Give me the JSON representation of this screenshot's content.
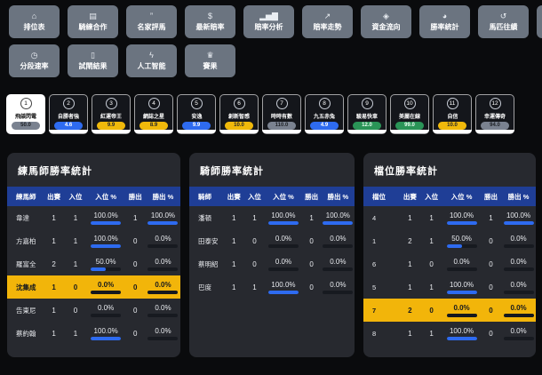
{
  "colors": {
    "background": "#0a0b0d",
    "nav_button": "#6b7480",
    "panel": "#27292f",
    "table_header": "#1f3e96",
    "highlight_row": "#f2b50a",
    "bar_fill": "#2e6bf0",
    "badge_blue": "#2e6bf0",
    "badge_yellow": "#f0b90b",
    "badge_green": "#2a9457",
    "badge_gray": "#7a8290"
  },
  "nav": {
    "row1": [
      {
        "label": "排位表",
        "icon": "home-icon",
        "glyph": "⌂"
      },
      {
        "label": "騎練合作",
        "icon": "id-card-icon",
        "glyph": "▤"
      },
      {
        "label": "名家評馬",
        "icon": "quote-icon",
        "glyph": "”"
      },
      {
        "label": "最新賠率",
        "icon": "dollar-icon",
        "glyph": "$"
      },
      {
        "label": "賠率分析",
        "icon": "bar-chart-icon",
        "glyph": "▂▅▇"
      },
      {
        "label": "賠率走勢",
        "icon": "line-chart-icon",
        "glyph": "↗"
      },
      {
        "label": "資金流向",
        "icon": "droplet-icon",
        "glyph": "◈"
      },
      {
        "label": "勝率統計",
        "icon": "pie-chart-icon",
        "glyph": "◕"
      },
      {
        "label": "馬匹往績",
        "icon": "history-icon",
        "glyph": "↺"
      },
      {
        "label": "",
        "icon": "partial-button",
        "glyph": "",
        "partial": true
      }
    ],
    "row2": [
      {
        "label": "分段速率",
        "icon": "clock-icon",
        "glyph": "◷"
      },
      {
        "label": "試閘結果",
        "icon": "gate-icon",
        "glyph": "▯"
      },
      {
        "label": "人工智能",
        "icon": "lightning-icon",
        "glyph": "ϟ"
      },
      {
        "label": "賽果",
        "icon": "trophy-icon",
        "glyph": "♛"
      }
    ]
  },
  "horses": [
    {
      "num": "1",
      "name": "飛燄閃電",
      "odds": "50.0",
      "badge": "gray",
      "selected": true
    },
    {
      "num": "2",
      "name": "自勝者強",
      "odds": "4.6",
      "badge": "blue",
      "selected": false
    },
    {
      "num": "3",
      "name": "紅運帝王",
      "odds": "9.9",
      "badge": "yellow",
      "selected": false
    },
    {
      "num": "4",
      "name": "網誌之星",
      "odds": "8.9",
      "badge": "yellow",
      "selected": false
    },
    {
      "num": "5",
      "name": "安逸",
      "odds": "9.9",
      "badge": "blue",
      "selected": false
    },
    {
      "num": "6",
      "name": "創新智感",
      "odds": "10.0",
      "badge": "yellow",
      "selected": false
    },
    {
      "num": "7",
      "name": "時時有數",
      "odds": "110.0",
      "badge": "gray",
      "selected": false
    },
    {
      "num": "8",
      "name": "九五赤兔",
      "odds": "4.9",
      "badge": "blue",
      "selected": false
    },
    {
      "num": "9",
      "name": "駿易快車",
      "odds": "12.0",
      "badge": "green",
      "selected": false
    },
    {
      "num": "10",
      "name": "美麗在線",
      "odds": "99.0",
      "badge": "green",
      "selected": false
    },
    {
      "num": "11",
      "name": "自信",
      "odds": "10.0",
      "badge": "yellow",
      "selected": false
    },
    {
      "num": "12",
      "name": "幸運傳奇",
      "odds": "94.0",
      "badge": "gray",
      "selected": false
    }
  ],
  "tables": [
    {
      "title": "練馬師勝率統計",
      "columns": [
        "練馬師",
        "出賽",
        "入位",
        "入位 %",
        "勝出",
        "勝出 %"
      ],
      "rows": [
        {
          "name": "韋達",
          "starts": "1",
          "placed": "1",
          "place_pct": "100.0%",
          "place_val": 100,
          "wins": "1",
          "win_pct": "100.0%",
          "win_val": 100,
          "highlight": false
        },
        {
          "name": "方嘉柏",
          "starts": "1",
          "placed": "1",
          "place_pct": "100.0%",
          "place_val": 100,
          "wins": "0",
          "win_pct": "0.0%",
          "win_val": 0,
          "highlight": false
        },
        {
          "name": "羅富全",
          "starts": "2",
          "placed": "1",
          "place_pct": "50.0%",
          "place_val": 50,
          "wins": "0",
          "win_pct": "0.0%",
          "win_val": 0,
          "highlight": false
        },
        {
          "name": "沈集成",
          "starts": "1",
          "placed": "0",
          "place_pct": "0.0%",
          "place_val": 0,
          "wins": "0",
          "win_pct": "0.0%",
          "win_val": 0,
          "highlight": true
        },
        {
          "name": "告東尼",
          "starts": "1",
          "placed": "0",
          "place_pct": "0.0%",
          "place_val": 0,
          "wins": "0",
          "win_pct": "0.0%",
          "win_val": 0,
          "highlight": false
        },
        {
          "name": "蔡約翰",
          "starts": "1",
          "placed": "1",
          "place_pct": "100.0%",
          "place_val": 100,
          "wins": "0",
          "win_pct": "0.0%",
          "win_val": 0,
          "highlight": false
        }
      ]
    },
    {
      "title": "騎師勝率統計",
      "columns": [
        "騎師",
        "出賽",
        "入位",
        "入位 %",
        "勝出",
        "勝出 %"
      ],
      "rows": [
        {
          "name": "潘頓",
          "starts": "1",
          "placed": "1",
          "place_pct": "100.0%",
          "place_val": 100,
          "wins": "1",
          "win_pct": "100.0%",
          "win_val": 100,
          "highlight": false
        },
        {
          "name": "田泰安",
          "starts": "1",
          "placed": "0",
          "place_pct": "0.0%",
          "place_val": 0,
          "wins": "0",
          "win_pct": "0.0%",
          "win_val": 0,
          "highlight": false
        },
        {
          "name": "蔡明紹",
          "starts": "1",
          "placed": "0",
          "place_pct": "0.0%",
          "place_val": 0,
          "wins": "0",
          "win_pct": "0.0%",
          "win_val": 0,
          "highlight": false
        },
        {
          "name": "巴度",
          "starts": "1",
          "placed": "1",
          "place_pct": "100.0%",
          "place_val": 100,
          "wins": "0",
          "win_pct": "0.0%",
          "win_val": 0,
          "highlight": false
        }
      ]
    },
    {
      "title": "檔位勝率統計",
      "columns": [
        "檔位",
        "出賽",
        "入位",
        "入位 %",
        "勝出",
        "勝出 %"
      ],
      "rows": [
        {
          "name": "4",
          "starts": "1",
          "placed": "1",
          "place_pct": "100.0%",
          "place_val": 100,
          "wins": "1",
          "win_pct": "100.0%",
          "win_val": 100,
          "highlight": false
        },
        {
          "name": "1",
          "starts": "2",
          "placed": "1",
          "place_pct": "50.0%",
          "place_val": 50,
          "wins": "0",
          "win_pct": "0.0%",
          "win_val": 0,
          "highlight": false
        },
        {
          "name": "6",
          "starts": "1",
          "placed": "0",
          "place_pct": "0.0%",
          "place_val": 0,
          "wins": "0",
          "win_pct": "0.0%",
          "win_val": 0,
          "highlight": false
        },
        {
          "name": "5",
          "starts": "1",
          "placed": "1",
          "place_pct": "100.0%",
          "place_val": 100,
          "wins": "0",
          "win_pct": "0.0%",
          "win_val": 0,
          "highlight": false
        },
        {
          "name": "7",
          "starts": "2",
          "placed": "0",
          "place_pct": "0.0%",
          "place_val": 0,
          "wins": "0",
          "win_pct": "0.0%",
          "win_val": 0,
          "highlight": true
        },
        {
          "name": "8",
          "starts": "1",
          "placed": "1",
          "place_pct": "100.0%",
          "place_val": 100,
          "wins": "0",
          "win_pct": "0.0%",
          "win_val": 0,
          "highlight": false
        }
      ]
    }
  ]
}
